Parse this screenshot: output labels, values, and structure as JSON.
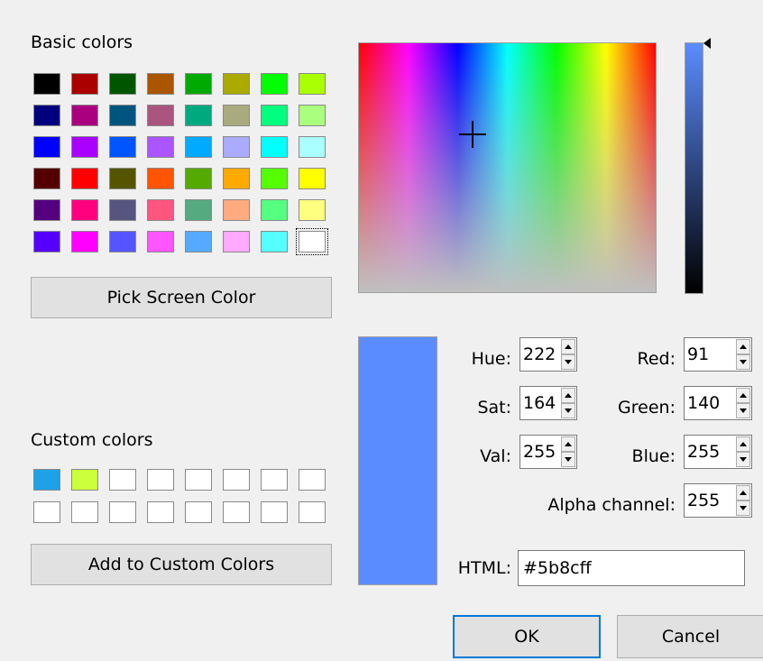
{
  "basic_colors": {
    "label": "Basic colors",
    "rows": [
      [
        "#000000",
        "#aa0000",
        "#005500",
        "#aa5500",
        "#00aa00",
        "#aaaa00",
        "#00ff00",
        "#aaff00"
      ],
      [
        "#00007f",
        "#aa007f",
        "#00557f",
        "#aa557f",
        "#00aa7f",
        "#aaaa7f",
        "#00ff7f",
        "#aaff7f"
      ],
      [
        "#0000ff",
        "#aa00ff",
        "#0055ff",
        "#aa55ff",
        "#00aaff",
        "#aaaaff",
        "#00ffff",
        "#aaffff"
      ],
      [
        "#550000",
        "#ff0000",
        "#555500",
        "#ff5500",
        "#55aa00",
        "#ffaa00",
        "#55ff00",
        "#ffff00"
      ],
      [
        "#55007f",
        "#ff007f",
        "#55557f",
        "#ff557f",
        "#55aa7f",
        "#ffaa7f",
        "#55ff7f",
        "#ffff7f"
      ],
      [
        "#5500ff",
        "#ff00ff",
        "#5555ff",
        "#ff55ff",
        "#55aaff",
        "#ffaaff",
        "#55ffff",
        "#ffffff"
      ]
    ],
    "selected_index": [
      5,
      7
    ]
  },
  "pick_screen_button": "Pick Screen Color",
  "custom_colors": {
    "label": "Custom colors",
    "rows": [
      [
        "#1da1e8",
        "#ccff3c",
        "#ffffff",
        "#ffffff",
        "#ffffff",
        "#ffffff",
        "#ffffff",
        "#ffffff"
      ],
      [
        "#ffffff",
        "#ffffff",
        "#ffffff",
        "#ffffff",
        "#ffffff",
        "#ffffff",
        "#ffffff",
        "#ffffff"
      ]
    ]
  },
  "add_custom_button": "Add to Custom Colors",
  "current_color": "#5b8cff",
  "fields": {
    "hue": {
      "label": "Hue:",
      "value": "222"
    },
    "sat": {
      "label": "Sat:",
      "value": "164"
    },
    "val": {
      "label": "Val:",
      "value": "255"
    },
    "red": {
      "label": "Red:",
      "value": "91"
    },
    "green": {
      "label": "Green:",
      "value": "140"
    },
    "blue": {
      "label": "Blue:",
      "value": "255"
    },
    "alpha": {
      "label": "Alpha channel:",
      "value": "255"
    },
    "html": {
      "label": "HTML:",
      "value": "#5b8cff"
    }
  },
  "ok_button": "OK",
  "cancel_button": "Cancel"
}
